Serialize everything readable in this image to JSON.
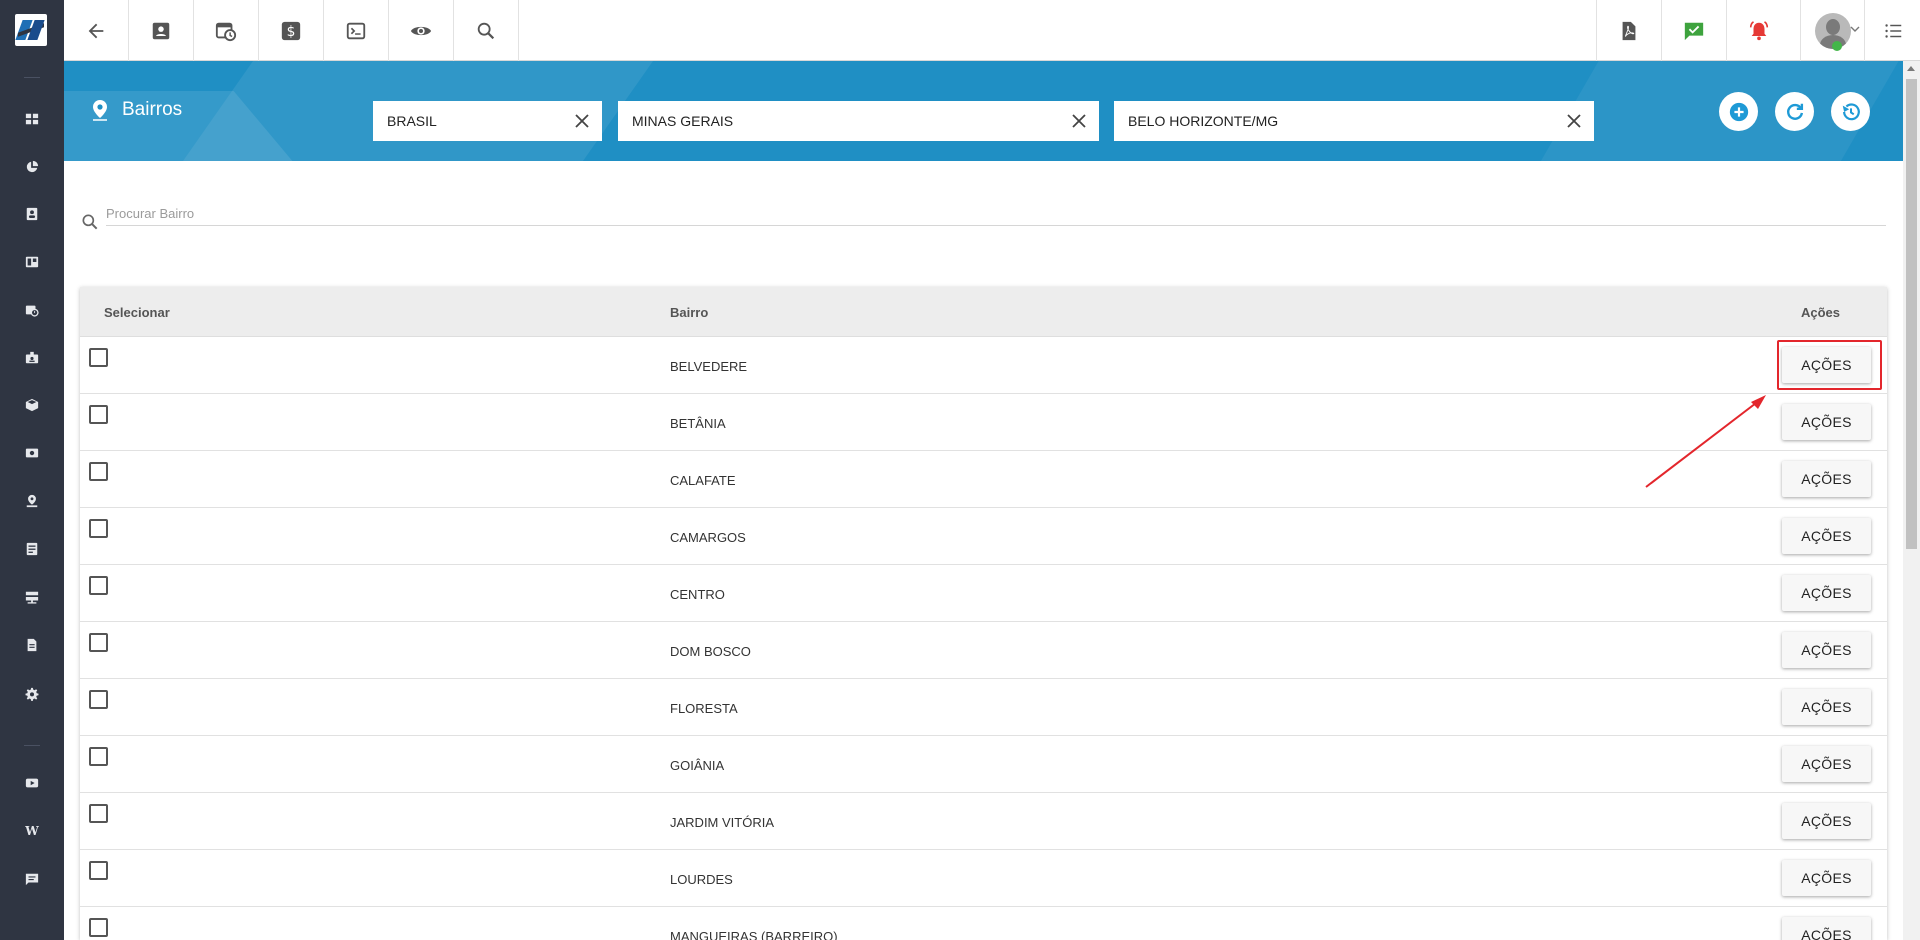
{
  "sidebar": {
    "items": [
      {
        "icon": "dashboard-icon"
      },
      {
        "icon": "pie-chart-icon"
      },
      {
        "icon": "contact-card-icon"
      },
      {
        "icon": "board-icon"
      },
      {
        "icon": "calendar-clock-icon"
      },
      {
        "icon": "badge-icon"
      },
      {
        "icon": "cube-icon"
      },
      {
        "icon": "money-icon"
      },
      {
        "icon": "map-pin-icon"
      },
      {
        "icon": "list-icon"
      },
      {
        "icon": "server-icon"
      },
      {
        "icon": "document-icon"
      },
      {
        "icon": "gear-icon"
      }
    ],
    "bottom_items": [
      {
        "icon": "video-icon"
      },
      {
        "icon": "wiki-icon",
        "letter": "W"
      },
      {
        "icon": "chat-icon"
      }
    ]
  },
  "topbar": {
    "left_icons": [
      "back-arrow-icon",
      "contact-card-icon",
      "calendar-clock-icon",
      "dollar-icon",
      "terminal-icon",
      "eye-icon",
      "search-icon"
    ],
    "right_icons": [
      "pdf-icon",
      "chat-check-icon",
      "alarm-bell-icon"
    ],
    "menu_icon": "menu-list-icon"
  },
  "header": {
    "title": "Bairros",
    "filters": [
      {
        "value": "BRASIL"
      },
      {
        "value": "MINAS GERAIS"
      },
      {
        "value": "BELO HORIZONTE/MG"
      }
    ],
    "actions": [
      "add-icon",
      "refresh-icon",
      "history-icon"
    ]
  },
  "search": {
    "placeholder": "Procurar Bairro"
  },
  "table": {
    "columns": {
      "select": "Selecionar",
      "name": "Bairro",
      "actions": "Ações"
    },
    "action_label": "AÇÕES",
    "rows": [
      {
        "name": "BELVEDERE"
      },
      {
        "name": "BETÂNIA"
      },
      {
        "name": "CALAFATE"
      },
      {
        "name": "CAMARGOS"
      },
      {
        "name": "CENTRO"
      },
      {
        "name": "DOM BOSCO"
      },
      {
        "name": "FLORESTA"
      },
      {
        "name": "GOIÂNIA"
      },
      {
        "name": "JARDIM VITÓRIA"
      },
      {
        "name": "LOURDES"
      },
      {
        "name": "MANGUEIRAS (BARREIRO)"
      }
    ]
  },
  "colors": {
    "sidebar": "#2f3542",
    "banner": "#1f8fc4",
    "accent": "#1e9ad6",
    "annotation": "#e3262c"
  }
}
